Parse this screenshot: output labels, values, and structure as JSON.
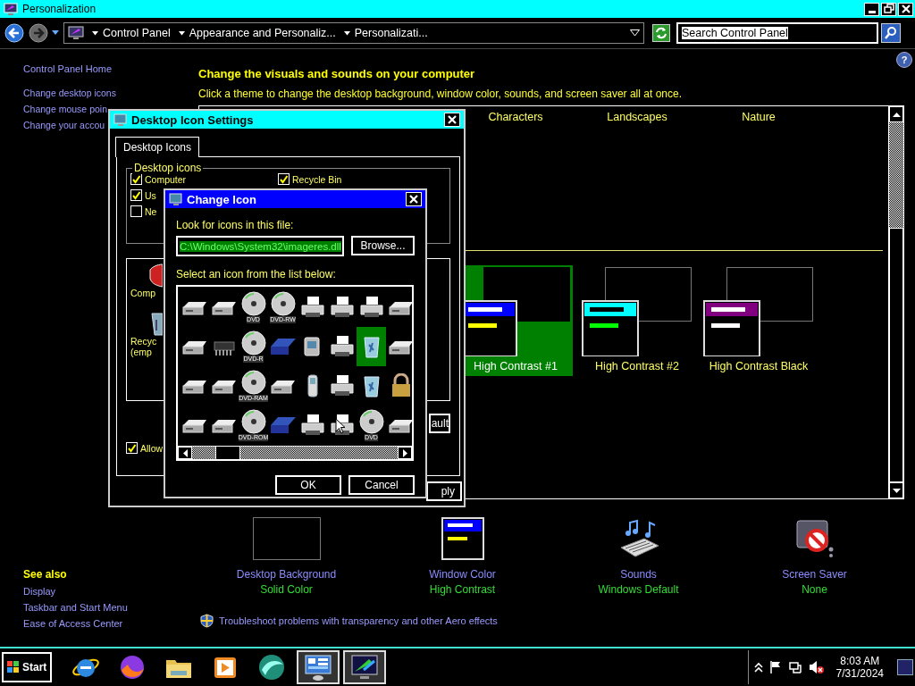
{
  "window": {
    "title": "Personalization"
  },
  "address_bar": {
    "crumbs": [
      "Control Panel",
      "Appearance and Personaliz...",
      "Personalizati..."
    ],
    "search": "Search Control Panel"
  },
  "sidebar": {
    "home": "Control Panel Home",
    "tasks": [
      "Change desktop icons",
      "Change mouse poin",
      "Change your accou"
    ],
    "see_also_title": "See also",
    "see_also": [
      "Display",
      "Taskbar and Start Menu",
      "Ease of Access Center"
    ]
  },
  "main": {
    "help_button": "?",
    "heading": "Change the visuals and sounds on your computer",
    "subtitle": "Click a theme to change the desktop background, window color, sounds, and screen saver all at once.",
    "theme_groups": [
      "Characters",
      "Landscapes",
      "Nature"
    ],
    "themes": [
      {
        "name": "High Contrast #1",
        "selected": true,
        "preview_bars": [
          {
            "color": "#0000ff"
          },
          {
            "color": "#ffff00"
          }
        ]
      },
      {
        "name": "High Contrast #2",
        "selected": false,
        "preview_bars": [
          {
            "color": "#00ffff"
          },
          {
            "color": "#00ff00"
          }
        ]
      },
      {
        "name": "High Contrast Black",
        "selected": false,
        "preview_bars": [
          {
            "color": "#800080"
          },
          {
            "color": "#ffffff"
          }
        ]
      }
    ],
    "settings": [
      {
        "kind": "background",
        "label": "Desktop Background",
        "value": "Solid Color"
      },
      {
        "kind": "window-color",
        "label": "Window Color",
        "value": "High Contrast"
      },
      {
        "kind": "sounds",
        "label": "Sounds",
        "value": "Windows Default"
      },
      {
        "kind": "screen-saver",
        "label": "Screen Saver",
        "value": "None"
      }
    ],
    "troubleshoot": "Troubleshoot problems with transparency and other Aero effects"
  },
  "desktop_icon_settings": {
    "title": "Desktop Icon Settings",
    "tab": "Desktop Icons",
    "group": "Desktop icons",
    "checkboxes": [
      {
        "label": "Computer",
        "checked": true
      },
      {
        "label": "Recycle Bin",
        "checked": true
      },
      {
        "label": "Us",
        "checked": true
      },
      {
        "label": "Ne",
        "checked": false
      }
    ],
    "preview_labels": [
      "Comp",
      "Recyc",
      "(emp"
    ],
    "restore_button": "ault",
    "allow": {
      "label": "Allow",
      "checked": true
    },
    "apply_button": "ply"
  },
  "change_icon": {
    "title": "Change Icon",
    "file_label": "Look for icons in this file:",
    "file": "C:\\Windows\\System32\\imageres.dll",
    "browse": "Browse...",
    "list_label": "Select an icon from the list below:",
    "icons": [
      {
        "kind": "drive",
        "selected": false
      },
      {
        "kind": "drive",
        "selected": false
      },
      {
        "kind": "dvd",
        "label": "DVD",
        "selected": false
      },
      {
        "kind": "dvd",
        "label": "DVD-RW",
        "selected": false
      },
      {
        "kind": "printer",
        "selected": false
      },
      {
        "kind": "printer",
        "selected": false
      },
      {
        "kind": "printer",
        "selected": false
      },
      {
        "kind": "drive",
        "selected": false
      },
      {
        "kind": "drive",
        "selected": false
      },
      {
        "kind": "chip",
        "selected": false
      },
      {
        "kind": "dvd",
        "label": "DVD-R",
        "selected": false
      },
      {
        "kind": "disk",
        "selected": false
      },
      {
        "kind": "camera",
        "selected": false
      },
      {
        "kind": "printer",
        "selected": false
      },
      {
        "kind": "bin",
        "selected": true
      },
      {
        "kind": "drive",
        "selected": false
      },
      {
        "kind": "drive",
        "selected": false
      },
      {
        "kind": "drive",
        "selected": false
      },
      {
        "kind": "dvd",
        "label": "DVD-RAM",
        "selected": false
      },
      {
        "kind": "drive",
        "selected": false
      },
      {
        "kind": "phone",
        "selected": false
      },
      {
        "kind": "printer",
        "selected": false
      },
      {
        "kind": "bin",
        "selected": false
      },
      {
        "kind": "lock",
        "selected": false
      },
      {
        "kind": "drive",
        "selected": false
      },
      {
        "kind": "drive",
        "selected": false
      },
      {
        "kind": "dvd",
        "label": "DVD-ROM",
        "selected": false
      },
      {
        "kind": "disk",
        "selected": false
      },
      {
        "kind": "printer",
        "selected": false
      },
      {
        "kind": "printer",
        "selected": false
      },
      {
        "kind": "dvd",
        "label": "DVD",
        "selected": false
      },
      {
        "kind": "drive",
        "selected": false
      }
    ],
    "ok": "OK",
    "cancel": "Cancel"
  },
  "taskbar": {
    "start": "Start",
    "apps": [
      {
        "kind": "e-logo",
        "active": false
      },
      {
        "kind": "fox",
        "active": false
      },
      {
        "kind": "folder",
        "active": false
      },
      {
        "kind": "media",
        "active": false
      },
      {
        "kind": "globe",
        "active": false
      },
      {
        "kind": "control-panel",
        "active": true
      },
      {
        "kind": "monitor",
        "active": true
      }
    ],
    "time": "8:03 AM",
    "date": "7/31/2024"
  }
}
